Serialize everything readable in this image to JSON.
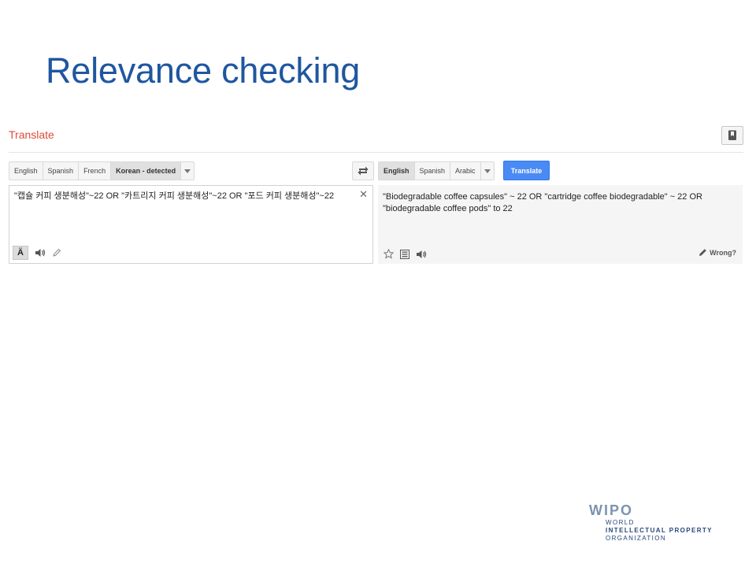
{
  "slide": {
    "title": "Relevance checking"
  },
  "app": {
    "title": "Translate"
  },
  "source_languages": {
    "tabs": [
      {
        "label": "English",
        "active": false
      },
      {
        "label": "Spanish",
        "active": false
      },
      {
        "label": "French",
        "active": false
      },
      {
        "label": "Korean - detected",
        "active": true
      }
    ]
  },
  "target_languages": {
    "tabs": [
      {
        "label": "English",
        "active": true
      },
      {
        "label": "Spanish",
        "active": false
      },
      {
        "label": "Arabic",
        "active": false
      }
    ]
  },
  "translate_button": {
    "label": "Translate"
  },
  "source": {
    "text": "\"캡슐 커피 생분해성\"~22 OR \"카트리지 커피 생분해성\"~22 OR \"포드 커피 생분해성\"~22"
  },
  "result": {
    "text": "\"Biodegradable coffee capsules\" ~ 22 OR \"cartridge coffee biodegradable\" ~ 22 OR \"biodegradable coffee pods\" to 22",
    "wrong_label": "Wrong?"
  },
  "ime_label": "Ä",
  "logo": {
    "mark": "WIPO",
    "lines": [
      "WORLD",
      "INTELLECTUAL PROPERTY",
      "ORGANIZATION"
    ]
  },
  "colors": {
    "title": "#1f56a0",
    "app_title": "#dd4b39",
    "translate_button": "#4a8af4",
    "logo_mark": "#7b93b2",
    "logo_text": "#27457a"
  }
}
